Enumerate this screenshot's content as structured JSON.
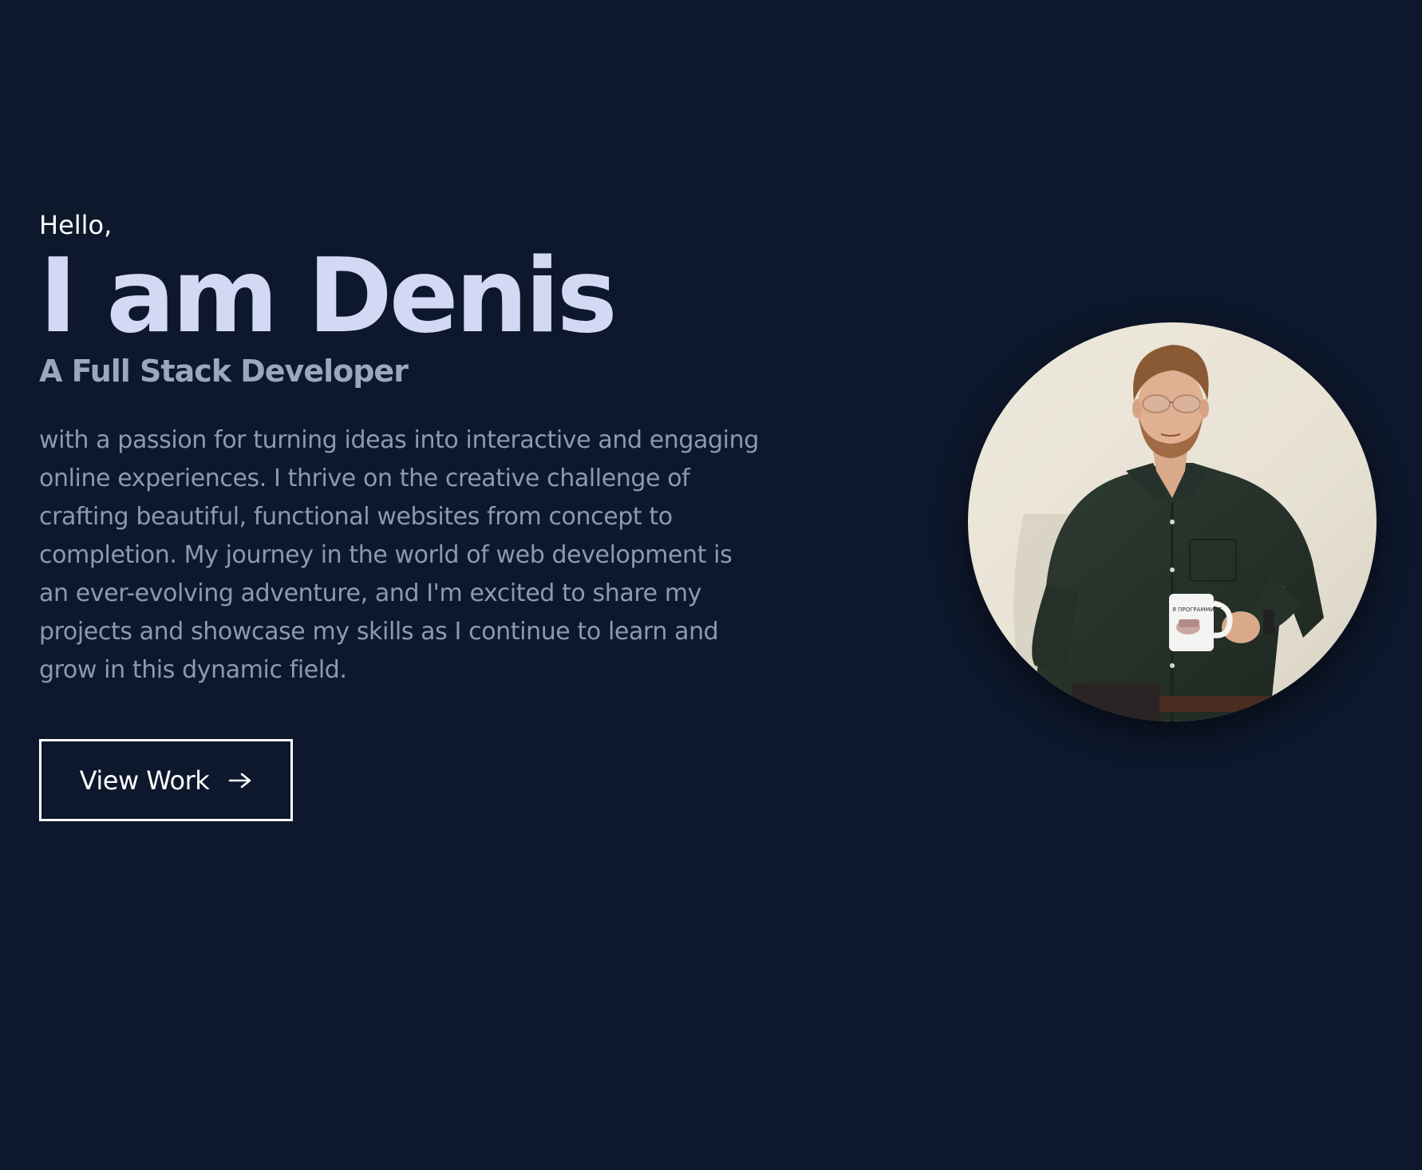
{
  "hero": {
    "greeting": "Hello,",
    "name": "I am Denis",
    "role": "A Full Stack Developer",
    "bio": "with a passion for turning ideas into interactive and engaging online experiences. I thrive on the creative challenge of crafting beautiful, functional websites from concept to completion. My journey in the world of web development is an ever-evolving adventure, and I'm excited to share my projects and showcase my skills as I continue to learn and grow in this dynamic field.",
    "cta_label": "View Work",
    "cta_icon": "arrow-right-icon",
    "avatar_mug_text": "Я ПРОГРАММИСТ"
  },
  "colors": {
    "background": "#0e182c",
    "name": "#d3d9f5",
    "role": "#9ca6bf",
    "bio": "#8e98b3",
    "button_border": "#ffffff"
  }
}
